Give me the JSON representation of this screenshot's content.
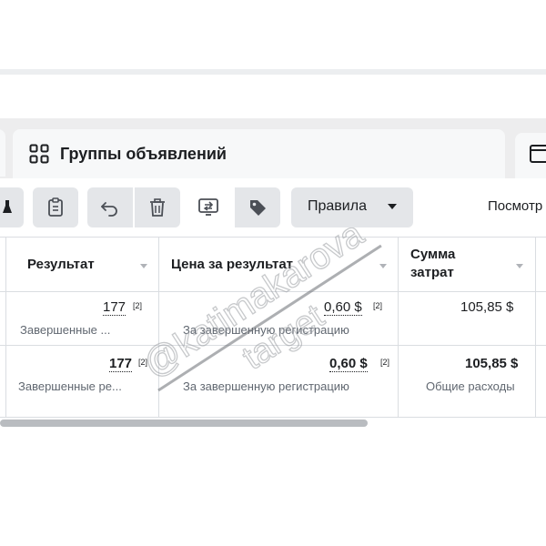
{
  "tabs": {
    "main_label": "Группы объявлений"
  },
  "toolbar": {
    "rules_label": "Правила",
    "view_label": "Посмотр"
  },
  "table": {
    "headers": {
      "result": "Результат",
      "cost_per_result": "Цена за результат",
      "amount_spent_line1": "Сумма",
      "amount_spent_line2": "затрат"
    },
    "rows": [
      {
        "result_value": "177",
        "result_note": "[2]",
        "result_sub": "Завершенные ...",
        "cost_value": "0,60 $",
        "cost_note": "[2]",
        "cost_sub": "За завершенную регистрацию",
        "spent_value": "105,85 $",
        "spent_sub": ""
      },
      {
        "result_value": "177",
        "result_note": "[2]",
        "result_sub": "Завершенные ре...",
        "cost_value": "0,60 $",
        "cost_note": "[2]",
        "cost_sub": "За завершенную регистрацию",
        "spent_value": "105,85 $",
        "spent_sub": "Общие расходы"
      }
    ]
  },
  "watermark": {
    "line1": "@katimakarova",
    "line2": "target"
  }
}
